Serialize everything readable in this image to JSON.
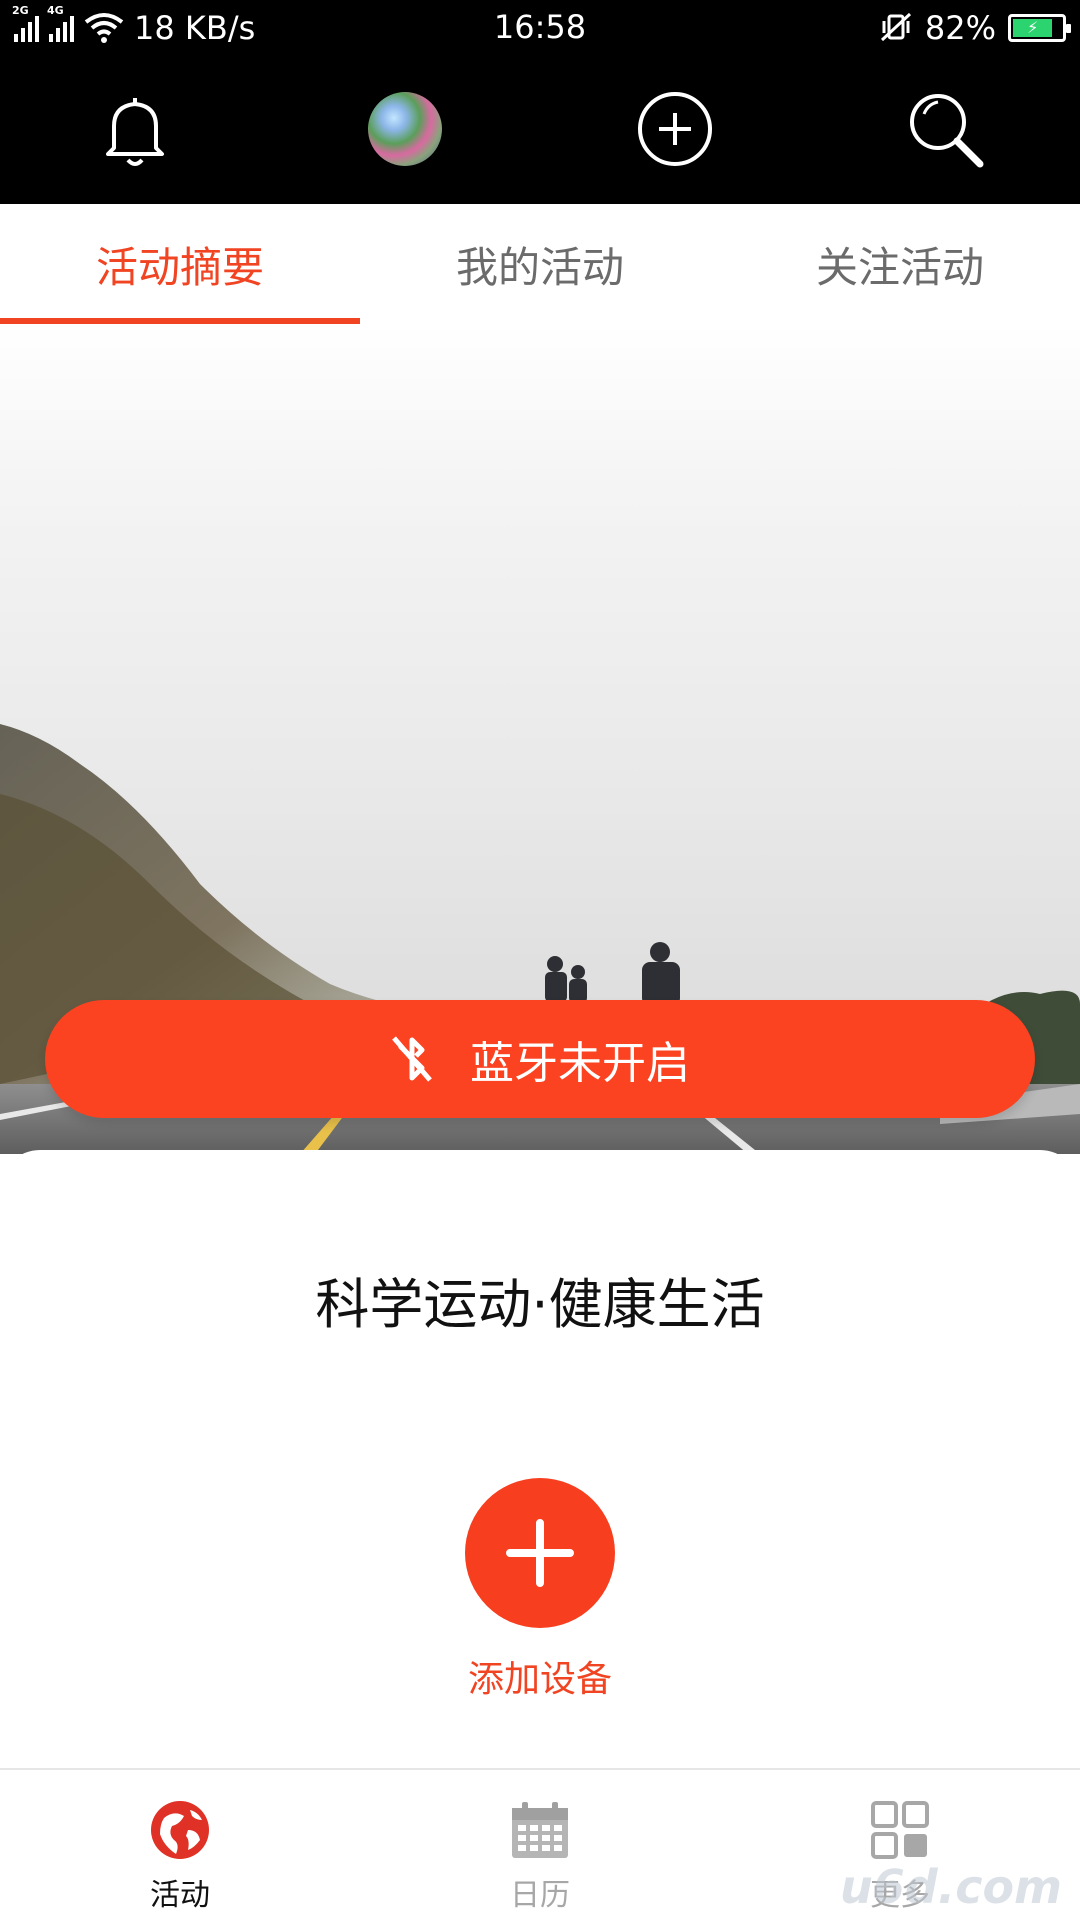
{
  "status_bar": {
    "network_speed": "18 KB/s",
    "time": "16:58",
    "battery_percent": "82%",
    "signal_1_tag": "2G",
    "signal_2_tag": "4G",
    "icons": [
      "signal-icon",
      "wifi-icon",
      "vibrate-icon",
      "battery-icon"
    ]
  },
  "toolbar": {
    "icons": [
      "bell-icon",
      "avatar",
      "add-circle-icon",
      "search-icon"
    ]
  },
  "tabs": [
    {
      "label": "活动摘要",
      "active": true
    },
    {
      "label": "我的活动",
      "active": false
    },
    {
      "label": "关注活动",
      "active": false
    }
  ],
  "hero": {
    "bluetooth_button_label": "蓝牙未开启",
    "bluetooth_icon": "bluetooth-off-icon"
  },
  "card": {
    "slogan": "科学运动·健康生活",
    "add_device_label": "添加设备"
  },
  "bottom_nav": [
    {
      "label": "活动",
      "icon": "globe-icon",
      "active": true
    },
    {
      "label": "日历",
      "icon": "calendar-icon",
      "active": false
    },
    {
      "label": "更多",
      "icon": "grid-icon",
      "active": false
    }
  ],
  "watermark": "u6d.com",
  "colors": {
    "accent": "#f04423",
    "button_red": "#fb4221",
    "inactive_text": "#a7a7a7"
  }
}
